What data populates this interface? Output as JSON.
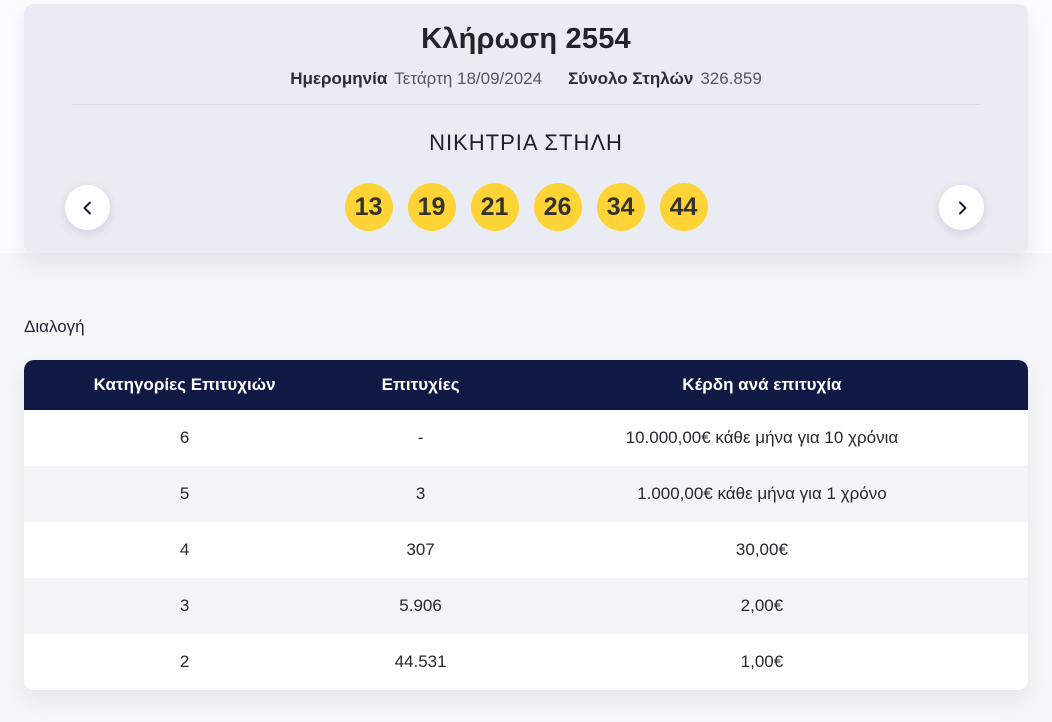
{
  "draw_card": {
    "title": "Κλήρωση 2554",
    "date_label": "Ημερομηνία",
    "date_value": "Τετάρτη 18/09/2024",
    "total_columns_label": "Σύνολο Στηλών",
    "total_columns_value": "326.859",
    "winning_column_title": "ΝΙΚΗΤΡΙΑ ΣΤΗΛΗ",
    "winning_numbers": [
      "13",
      "19",
      "21",
      "26",
      "34",
      "44"
    ]
  },
  "results": {
    "section_title": "Διαλογή",
    "table": {
      "headers": [
        "Κατηγορίες Επιτυχιών",
        "Επιτυχίες",
        "Κέρδη ανά επιτυχία"
      ],
      "rows": [
        {
          "category": "6",
          "winners": "-",
          "prize": "10.000,00€ κάθε μήνα για 10 χρόνια"
        },
        {
          "category": "5",
          "winners": "3",
          "prize": "1.000,00€ κάθε μήνα για 1 χρόνο"
        },
        {
          "category": "4",
          "winners": "307",
          "prize": "30,00€"
        },
        {
          "category": "3",
          "winners": "5.906",
          "prize": "2,00€"
        },
        {
          "category": "2",
          "winners": "44.531",
          "prize": "1,00€"
        }
      ]
    }
  },
  "colors": {
    "ball_yellow": "#FDD335",
    "table_header_navy": "#101A45",
    "card_background": "#E9ECF3",
    "page_background": "#F5F6F9"
  }
}
